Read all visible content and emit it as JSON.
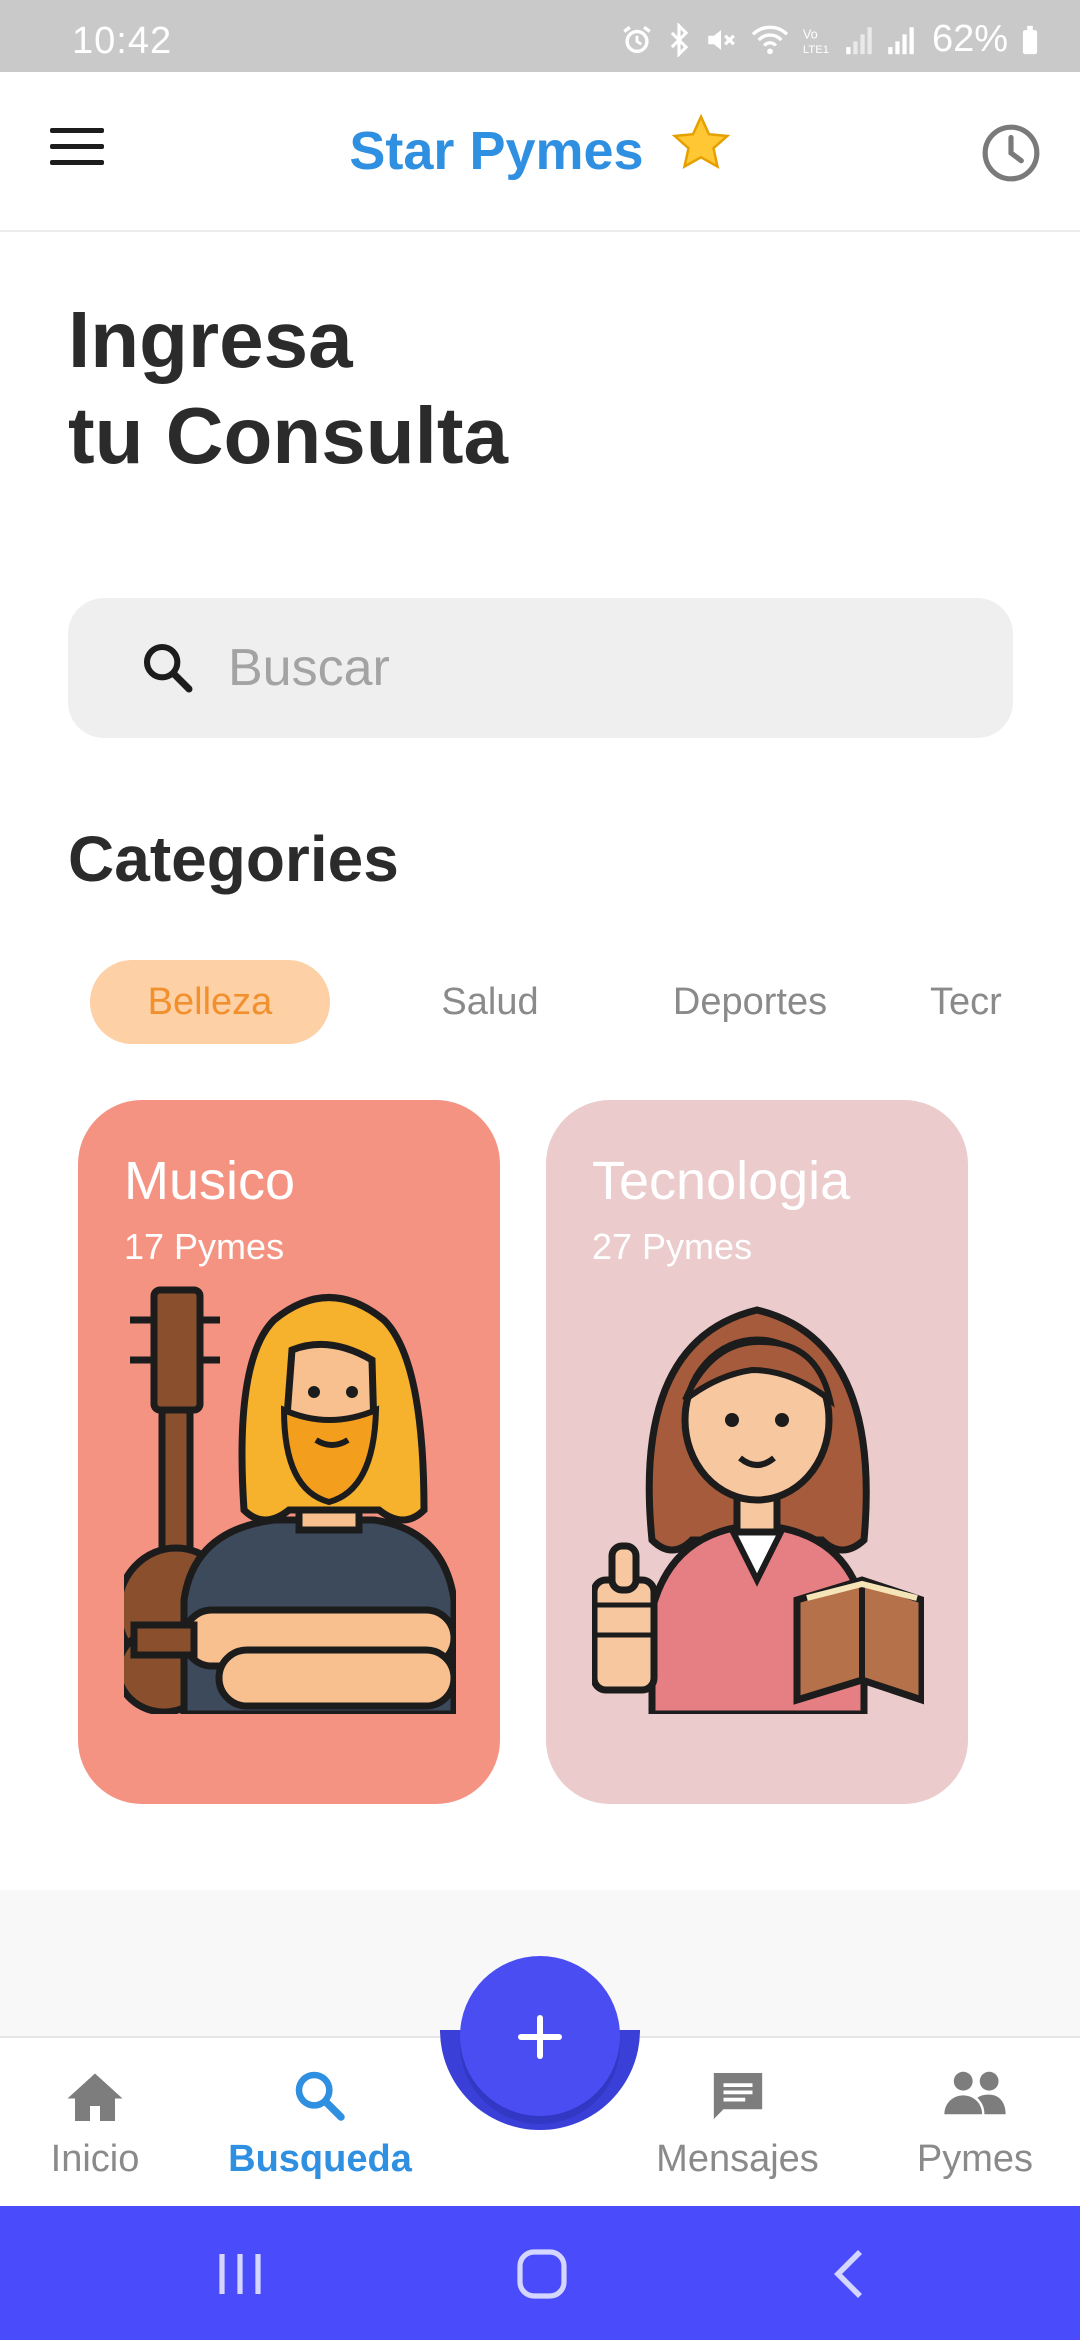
{
  "status_bar": {
    "time": "10:42",
    "battery": "62%",
    "icons": [
      "alarm-icon",
      "bluetooth-icon",
      "mute-icon",
      "wifi-icon",
      "volte-icon",
      "signal-icon",
      "signal-icon",
      "battery-icon"
    ]
  },
  "header": {
    "title": "Star Pymes",
    "icons": [
      "menu-icon",
      "star-icon",
      "history-icon"
    ]
  },
  "main": {
    "heading_line1": "Ingresa",
    "heading_line2": "tu Consulta",
    "search": {
      "placeholder": "Buscar",
      "value": ""
    },
    "categories_heading": "Categories",
    "chips": [
      {
        "label": "Belleza",
        "selected": true
      },
      {
        "label": "Salud",
        "selected": false
      },
      {
        "label": "Deportes",
        "selected": false
      },
      {
        "label": "Tecr",
        "selected": false
      }
    ],
    "cards": [
      {
        "title": "Musico",
        "count": "17 Pymes",
        "color": "#f59383",
        "illustration": "guitarist-illustration"
      },
      {
        "title": "Tecnologia",
        "count": "27 Pymes",
        "color": "#ebcbcb",
        "illustration": "woman-with-book-illustration"
      }
    ]
  },
  "bottom_nav": {
    "items": [
      {
        "label": "Inicio",
        "icon": "home-icon",
        "active": false
      },
      {
        "label": "Busqueda",
        "icon": "search-icon",
        "active": true
      },
      {
        "label": "Mensajes",
        "icon": "chat-icon",
        "active": false
      },
      {
        "label": "Pymes",
        "icon": "people-icon",
        "active": false
      }
    ],
    "fab_icon": "plus-icon"
  },
  "system_nav": {
    "icons": [
      "recents-icon",
      "home-outline-icon",
      "back-icon"
    ]
  },
  "colors": {
    "accent_blue": "#2f8fe0",
    "fab_indigo": "#4a4ef2",
    "chip_active_bg": "#fdd0a6",
    "chip_active_text": "#f2902d",
    "system_nav": "#4a4cfb"
  }
}
